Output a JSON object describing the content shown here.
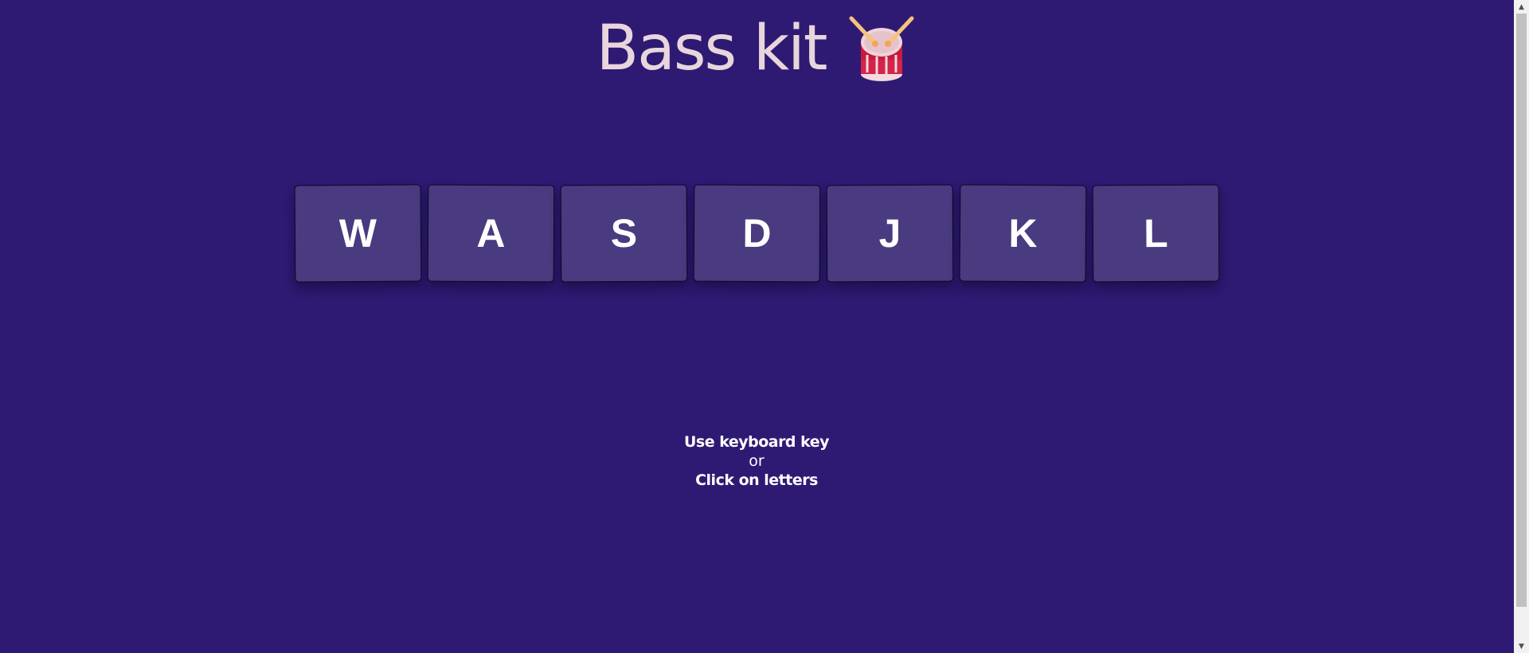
{
  "header": {
    "title": "Bass kit",
    "icon": "drum-icon"
  },
  "keys": [
    "W",
    "A",
    "S",
    "D",
    "J",
    "K",
    "L"
  ],
  "instructions": {
    "line1": "Use keyboard key",
    "line2": "or",
    "line3": "Click on letters"
  },
  "colors": {
    "background": "#2e1a73",
    "key_background": "#4a3a80",
    "title": "#e8d6dc",
    "text": "#ffffff"
  }
}
